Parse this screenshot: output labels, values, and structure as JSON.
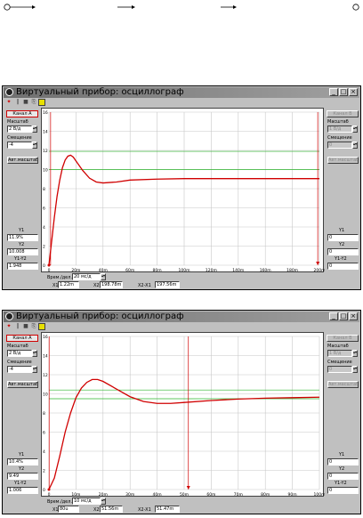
{
  "colors": {
    "trace": "#d00000",
    "cursor_h1": "#2db52d",
    "cursor_h2": "#2db52d",
    "cursor_v": "#d00000",
    "grid": "#c8c8c8",
    "extra_line_top": "#c000c0"
  },
  "windows": [
    {
      "title": "Виртуальный прибор: осциллограф",
      "left": {
        "channel_button": "Канал A",
        "scale_label": "Масштаб",
        "scale_value": "2 В/д",
        "offset_label": "Смещение",
        "offset_value": "-4",
        "auto_scale_button": "Авт.масштаб",
        "y1_label": "Y1",
        "y1_value": "11.9%",
        "y2_label": "Y2",
        "y2_value": "10.008",
        "dy_label": "Y1-Y2",
        "dy_value": "1.948"
      },
      "right": {
        "channel_button": "Канал B",
        "scale_label": "Масштаб",
        "scale_value": "1 В/д",
        "offset_label": "Смещение",
        "offset_value": "0",
        "auto_scale_button": "Авт.масштаб",
        "y1_label": "Y1",
        "y1_value": "0",
        "y2_label": "Y2",
        "y2_value": "0",
        "dy_label": "Y1-Y2",
        "dy_value": "0"
      },
      "bottom": {
        "time_label": "Врем./дел.",
        "time_value": "20 мс/д",
        "x1_label": "X1",
        "x1_value": "1.22m",
        "x2_label": "X2",
        "x2_value": "198.78m",
        "dx_label": "X2-X1",
        "dx_value": "197.56m"
      },
      "chart_data": {
        "type": "line",
        "y_ticks": [
          "16",
          "14",
          "12",
          "10",
          "8",
          "6",
          "4",
          "2",
          "0"
        ],
        "x_ticks": [
          "0",
          "20m",
          "40m",
          "60m",
          "80m",
          "100m",
          "120m",
          "140m",
          "160m",
          "180m",
          "200m"
        ],
        "xlim": [
          0,
          200
        ],
        "ylim": [
          0,
          16
        ],
        "series": [
          {
            "values_x": [
              0,
              2,
              4,
              6,
              8,
              10,
              12,
              14,
              16,
              18,
              20,
              25,
              30,
              35,
              40,
              50,
              60,
              80,
              100,
              120,
              140,
              160,
              180,
              200
            ],
            "values_y": [
              0,
              2.5,
              5.0,
              7.2,
              8.9,
              10.2,
              11.0,
              11.4,
              11.5,
              11.3,
              10.9,
              9.9,
              9.1,
              8.7,
              8.6,
              8.7,
              8.9,
              9.0,
              9.05,
              9.05,
              9.05,
              9.05,
              9.05,
              9.05
            ]
          }
        ],
        "cursor_h1_y": 11.9,
        "cursor_h2_y": 10.0,
        "cursor_v1_x": 1.22,
        "cursor_v2_x": 198.78
      }
    },
    {
      "title": "Виртуальный прибор: осциллограф",
      "left": {
        "channel_button": "Канал A",
        "scale_label": "Масштаб",
        "scale_value": "2 В/д",
        "offset_label": "Смещение",
        "offset_value": "-4",
        "auto_scale_button": "Авт.масштаб",
        "y1_label": "Y1",
        "y1_value": "10.4%",
        "y2_label": "Y2",
        "y2_value": "9.49",
        "dy_label": "Y1-Y2",
        "dy_value": "1.006"
      },
      "right": {
        "channel_button": "Канал B",
        "scale_label": "Масштаб",
        "scale_value": "1 В/д",
        "offset_label": "Смещение",
        "offset_value": "0",
        "auto_scale_button": "Авт.масштаб",
        "y1_label": "Y1",
        "y1_value": "0",
        "y2_label": "Y2",
        "y2_value": "0",
        "dy_label": "Y1-Y2",
        "dy_value": "0"
      },
      "bottom": {
        "time_label": "Врем./дел.",
        "time_value": "10 мс/д",
        "x1_label": "X1",
        "x1_value": "80u",
        "x2_label": "X2",
        "x2_value": "51.56m",
        "dx_label": "X2-X1",
        "dx_value": "51.47m"
      },
      "chart_data": {
        "type": "line",
        "y_ticks": [
          "16",
          "14",
          "12",
          "10",
          "8",
          "6",
          "4",
          "2",
          "0"
        ],
        "x_ticks": [
          "0",
          "10m",
          "20m",
          "30m",
          "40m",
          "50m",
          "60m",
          "70m",
          "80m",
          "90m",
          "100m"
        ],
        "xlim": [
          0,
          100
        ],
        "ylim": [
          0,
          16
        ],
        "series": [
          {
            "values_x": [
              0,
              2,
              4,
              6,
              8,
              10,
              12,
              14,
              16,
              18,
              20,
              25,
              30,
              35,
              40,
              45,
              50,
              60,
              70,
              80,
              90,
              100
            ],
            "values_y": [
              0,
              1.2,
              3.5,
              6.0,
              8.0,
              9.6,
              10.6,
              11.2,
              11.5,
              11.5,
              11.3,
              10.5,
              9.7,
              9.2,
              9.0,
              9.0,
              9.1,
              9.3,
              9.45,
              9.55,
              9.6,
              9.65
            ]
          }
        ],
        "cursor_h1_y": 10.4,
        "cursor_h2_y": 9.49,
        "cursor_v1_x": 0.08,
        "cursor_v2_x": 51.56
      }
    }
  ]
}
